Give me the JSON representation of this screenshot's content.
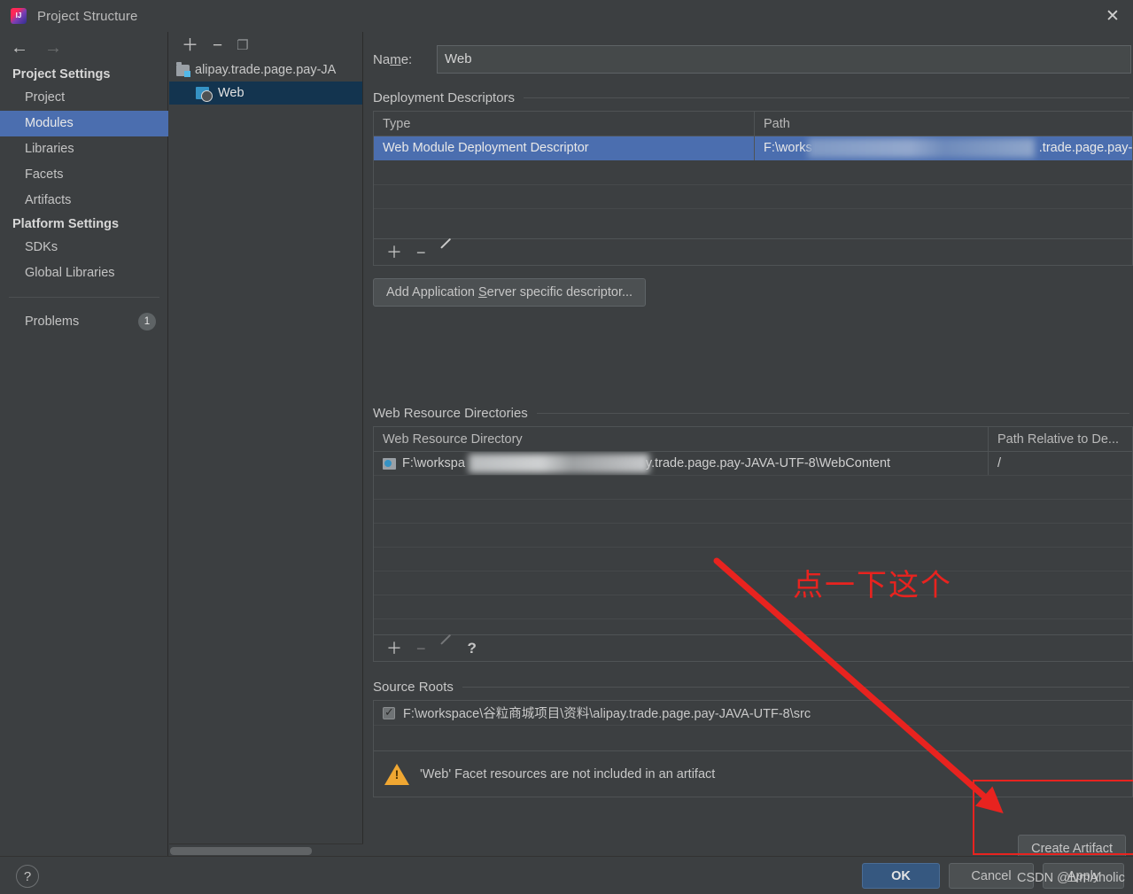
{
  "window": {
    "title": "Project Structure",
    "logo_icon": "intellij-idea-logo",
    "close_icon": "close-icon"
  },
  "sidebar": {
    "back_icon": "arrow-left-icon",
    "forward_icon": "arrow-right-icon",
    "groups": [
      {
        "title": "Project Settings",
        "items": [
          {
            "label": "Project",
            "selected": false
          },
          {
            "label": "Modules",
            "selected": true
          },
          {
            "label": "Libraries",
            "selected": false
          },
          {
            "label": "Facets",
            "selected": false
          },
          {
            "label": "Artifacts",
            "selected": false
          }
        ]
      },
      {
        "title": "Platform Settings",
        "items": [
          {
            "label": "SDKs",
            "selected": false
          },
          {
            "label": "Global Libraries",
            "selected": false
          }
        ]
      }
    ],
    "problems": {
      "label": "Problems",
      "count": "1"
    }
  },
  "module_tree": {
    "toolbar": {
      "add_icon": "plus-icon",
      "remove_icon": "minus-icon",
      "copy_icon": "copy-icon"
    },
    "nodes": [
      {
        "label": "alipay.trade.page.pay-JA",
        "icon": "module-icon",
        "selected": false
      },
      {
        "label": "Web",
        "icon": "web-facet-icon",
        "selected": true
      }
    ]
  },
  "main": {
    "name_field": {
      "label": "Name:",
      "mnemonic": "m",
      "value": "Web"
    },
    "deployment_descriptors": {
      "title": "Deployment Descriptors",
      "columns": [
        "Type",
        "Path"
      ],
      "rows": [
        {
          "type": "Web Module Deployment Descriptor",
          "path_prefix": "F:\\works",
          "path_suffix": ".trade.page.pay-",
          "selected": true
        }
      ],
      "toolbar": {
        "add_icon": "plus-icon",
        "remove_icon": "minus-icon",
        "edit_icon": "pencil-icon"
      },
      "add_descriptor_button": {
        "label_before": "Add Application ",
        "mnemonic": "S",
        "label_after": "erver specific descriptor..."
      }
    },
    "web_resource_directories": {
      "title": "Web Resource Directories",
      "columns": [
        "Web Resource Directory",
        "Path Relative to De..."
      ],
      "rows": [
        {
          "icon": "folder-web-icon",
          "dir_prefix": "F:\\workspa",
          "dir_suffix": "y.trade.page.pay-JAVA-UTF-8\\WebContent",
          "relative_path": "/"
        }
      ],
      "toolbar": {
        "add_icon": "plus-icon",
        "remove_icon": "minus-icon",
        "edit_icon": "pencil-icon",
        "help_icon": "question-icon"
      }
    },
    "source_roots": {
      "title": "Source Roots",
      "rows": [
        {
          "checked": true,
          "path": "F:\\workspace\\谷粒商城项目\\资料\\alipay.trade.page.pay-JAVA-UTF-8\\src"
        }
      ]
    },
    "warning": {
      "icon": "warning-triangle-icon",
      "message": "'Web' Facet resources are not included in an artifact"
    },
    "create_artifact_button": {
      "label_before": "Create Artif",
      "mnemonic": "a",
      "label_after": "ct"
    }
  },
  "bottom_bar": {
    "help_icon": "question-icon",
    "ok_label": "OK",
    "cancel_label": "Cancel",
    "apply_label_before": "",
    "apply_mnemonic": "A",
    "apply_label_after": "pply"
  },
  "annotations": {
    "callout_text": "点一下这个",
    "highlight_color": "#e8231f",
    "arrow_icon": "red-arrow-icon",
    "watermark": "CSDN @lvmAholic"
  },
  "colors": {
    "window_bg": "#3c3f41",
    "selection_blue": "#4b6eaf",
    "tree_selection": "#13344f",
    "ok_button": "#365880",
    "warning_amber": "#f0a732",
    "annotation_red": "#e8231f"
  }
}
